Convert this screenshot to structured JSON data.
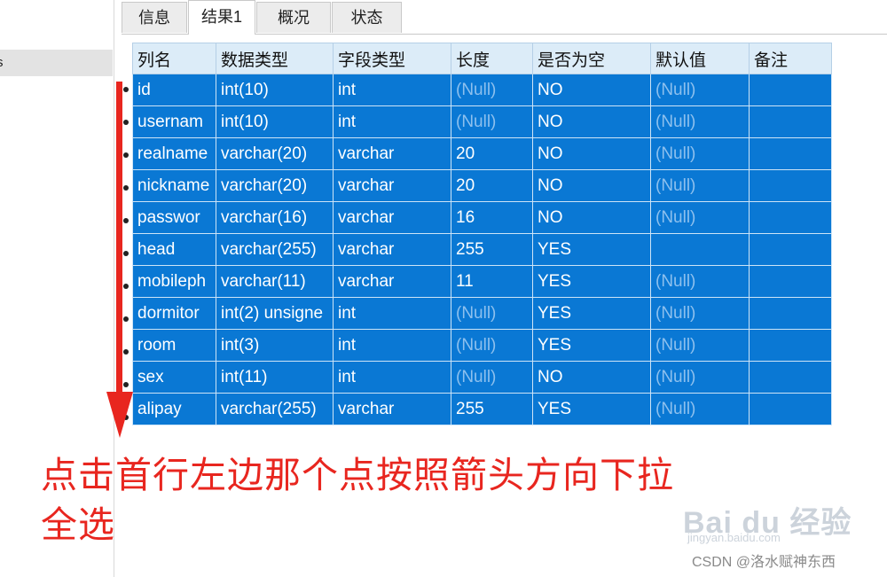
{
  "sidebar": {
    "items": [
      {
        "label": "s"
      }
    ]
  },
  "tabs": [
    {
      "label": "信息",
      "active": false
    },
    {
      "label": "结果1",
      "active": true
    },
    {
      "label": "概况",
      "active": false
    },
    {
      "label": "状态",
      "active": false
    }
  ],
  "table": {
    "columns": [
      "列名",
      "数据类型",
      "字段类型",
      "长度",
      "是否为空",
      "默认值",
      "备注"
    ],
    "rows": [
      [
        "id",
        "int(10)",
        "int",
        "(Null)",
        "NO",
        "(Null)",
        ""
      ],
      [
        "usernam",
        "int(10)",
        "int",
        "(Null)",
        "NO",
        "(Null)",
        ""
      ],
      [
        "realname",
        "varchar(20)",
        "varchar",
        "20",
        "NO",
        "(Null)",
        ""
      ],
      [
        "nickname",
        "varchar(20)",
        "varchar",
        "20",
        "NO",
        "(Null)",
        ""
      ],
      [
        "passwor",
        "varchar(16)",
        "varchar",
        "16",
        "NO",
        "(Null)",
        ""
      ],
      [
        "head",
        "varchar(255)",
        "varchar",
        "255",
        "YES",
        "",
        ""
      ],
      [
        "mobileph",
        "varchar(11)",
        "varchar",
        "11",
        "YES",
        "(Null)",
        ""
      ],
      [
        "dormitor",
        "int(2) unsigne",
        "int",
        "(Null)",
        "YES",
        "(Null)",
        ""
      ],
      [
        "room",
        "int(3)",
        "int",
        "(Null)",
        "YES",
        "(Null)",
        ""
      ],
      [
        "sex",
        "int(11)",
        "int",
        "(Null)",
        "NO",
        "(Null)",
        ""
      ],
      [
        "alipay",
        "varchar(255)",
        "varchar",
        "255",
        "YES",
        "(Null)",
        ""
      ]
    ]
  },
  "annotation": {
    "line1": "点击首行左边那个点按照箭头方向下拉",
    "line2": "全选",
    "color": "#e8261f"
  },
  "watermark": {
    "baidu": "Bai du 经验",
    "small": "jingyan.baidu.com"
  },
  "csdn_credit": "CSDN @洛水赋神东西",
  "colors": {
    "selection": "#0a78d4",
    "header": "#dcecf8",
    "null_text": "#8dc0ee",
    "arrow": "#e8261f"
  }
}
